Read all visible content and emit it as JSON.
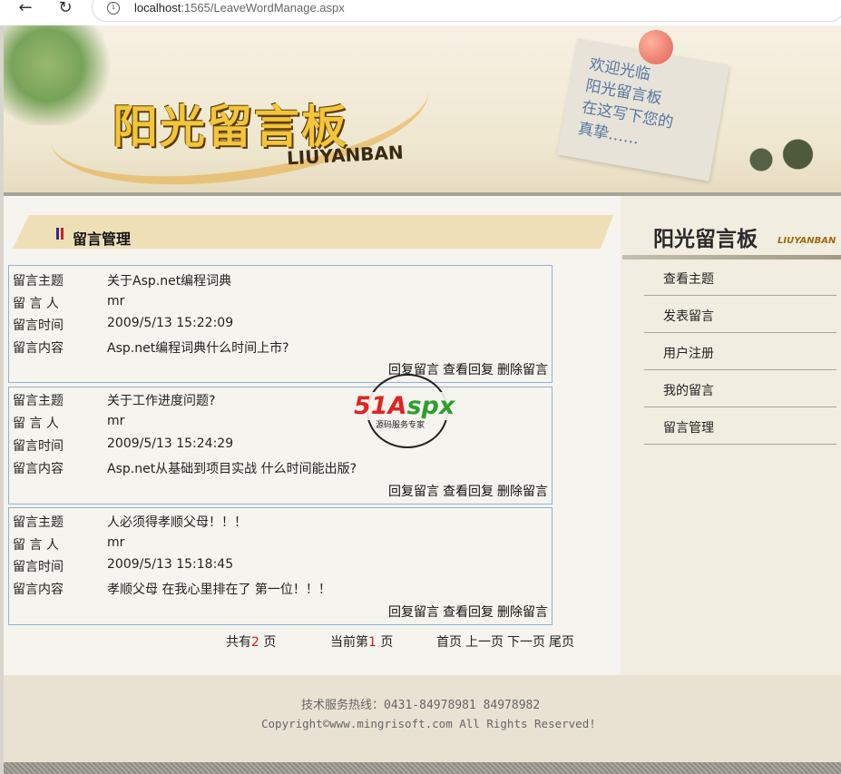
{
  "browser": {
    "url_host": "localhost",
    "url_rest": ":1565/LeaveWordManage.aspx"
  },
  "banner": {
    "title": "阳光留言板",
    "subtitle": "LIUYANBAN",
    "note_text": "欢迎光临\n阳光留言板\n在这写下您的\n真挚……"
  },
  "main": {
    "section_title": "留言管理",
    "labels": {
      "subject": "留言主题",
      "author": "留 言 人",
      "time": "留言时间",
      "content": "留言内容"
    },
    "messages": [
      {
        "subject": "关于Asp.net编程词典",
        "author": "mr",
        "time": "2009/5/13 15:22:09",
        "content": "Asp.net编程词典什么时间上市?"
      },
      {
        "subject": "关于工作进度问题?",
        "author": "mr",
        "time": "2009/5/13 15:24:29",
        "content": "Asp.net从基础到项目实战 什么时间能出版?"
      },
      {
        "subject": "人必须得孝顺父母！！！",
        "author": "mr",
        "time": "2009/5/13 15:18:45",
        "content": "孝顺父母 在我心里排在了 第一位！！！"
      }
    ],
    "actions": {
      "reply": "回复留言",
      "view_reply": "查看回复",
      "delete": "删除留言"
    },
    "pager": {
      "total_prefix": "共有",
      "total_pages": "2",
      "total_suffix": " 页",
      "current_prefix": "当前第",
      "current_page": "1",
      "current_suffix": " 页",
      "first": "首页",
      "prev": "上一页",
      "next": "下一页",
      "last": "尾页"
    }
  },
  "watermark": {
    "brand_red": "51A",
    "brand_green": "spx",
    "tagline": "源码服务专家"
  },
  "sidebar": {
    "title": "阳光留言板",
    "subtitle": "LIUYANBAN",
    "items": [
      {
        "label": "查看主题"
      },
      {
        "label": "发表留言"
      },
      {
        "label": "用户注册"
      },
      {
        "label": "我的留言"
      },
      {
        "label": "留言管理"
      }
    ]
  },
  "footer": {
    "hotline": "技术服务热线：0431-84978981   84978982",
    "copyright": "Copyright©www.mingrisoft.com All Rights Reserved!"
  },
  "colors": {
    "accent_red": "#d02020",
    "border_blue": "#8eb2d3",
    "title_bar": "#efdfb6"
  }
}
